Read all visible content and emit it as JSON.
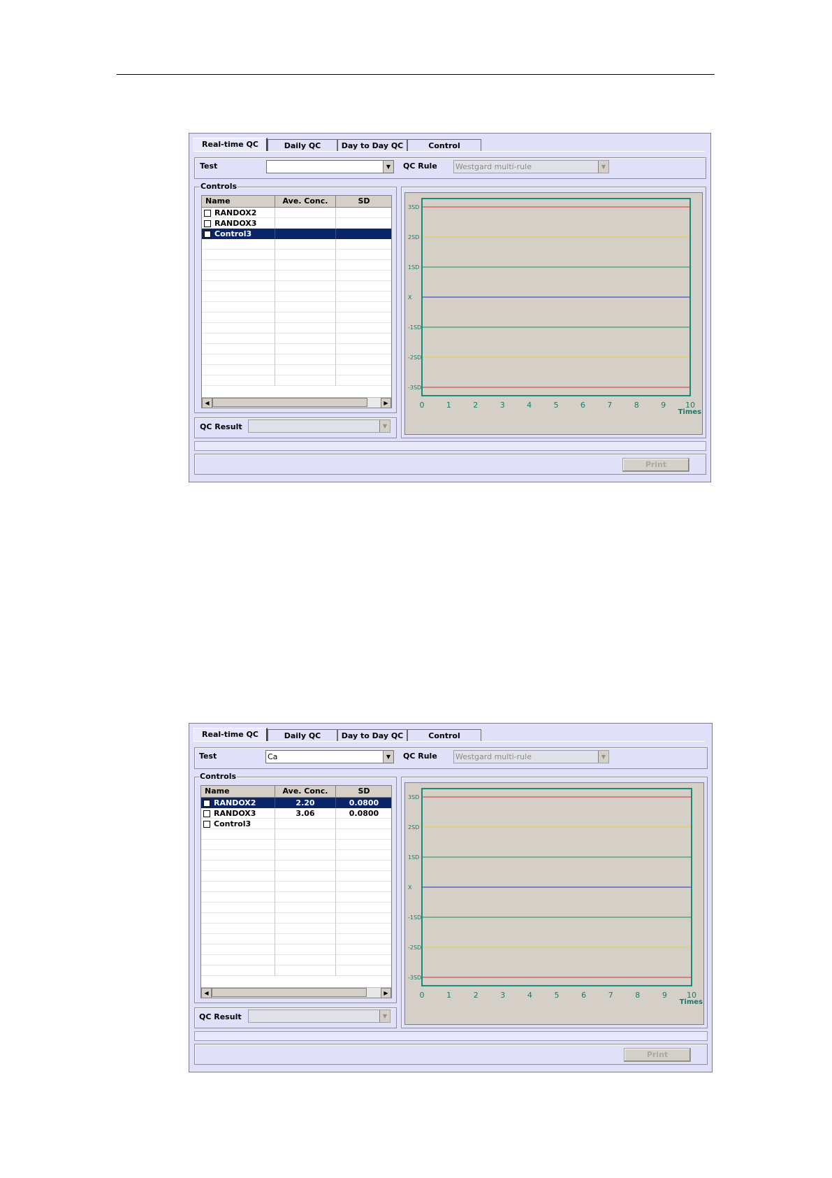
{
  "tabs": [
    "Real-time QC",
    "Daily QC",
    "Day to Day QC",
    "Control"
  ],
  "labels": {
    "test": "Test",
    "qc_rule": "QC Rule",
    "controls": "Controls",
    "qc_result": "QC Result",
    "print": "Print"
  },
  "columns": [
    "Name",
    "Ave. Conc.",
    "SD"
  ],
  "screen1": {
    "test_value": "",
    "qc_rule_value": "Westgard multi-rule",
    "selected_row": 2,
    "rows": [
      {
        "name": "RANDOX2",
        "ave": "",
        "sd": ""
      },
      {
        "name": "RANDOX3",
        "ave": "",
        "sd": ""
      },
      {
        "name": "Control3",
        "ave": "",
        "sd": ""
      }
    ]
  },
  "screen2": {
    "test_value": "Ca",
    "qc_rule_value": "Westgard multi-rule",
    "selected_row": 0,
    "rows": [
      {
        "name": "RANDOX2",
        "ave": "2.20",
        "sd": "0.0800"
      },
      {
        "name": "RANDOX3",
        "ave": "3.06",
        "sd": "0.0800"
      },
      {
        "name": "Control3",
        "ave": "",
        "sd": ""
      }
    ]
  },
  "chart_data": {
    "type": "line",
    "x_ticks": [
      "0",
      "1",
      "2",
      "3",
      "4",
      "5",
      "6",
      "7",
      "8",
      "9",
      "10"
    ],
    "xlabel": "Times",
    "y_labels": [
      "3SD",
      "2SD",
      "1SD",
      "X",
      "-1SD",
      "-2SD",
      "-3SD"
    ],
    "reference_lines": [
      {
        "label": "3SD",
        "color": "#e03030"
      },
      {
        "label": "2SD",
        "color": "#e8d040"
      },
      {
        "label": "1SD",
        "color": "#189050"
      },
      {
        "label": "X",
        "color": "#2030c8"
      },
      {
        "label": "-1SD",
        "color": "#189050"
      },
      {
        "label": "-2SD",
        "color": "#e8d040"
      },
      {
        "label": "-3SD",
        "color": "#e03030"
      }
    ],
    "series": []
  }
}
